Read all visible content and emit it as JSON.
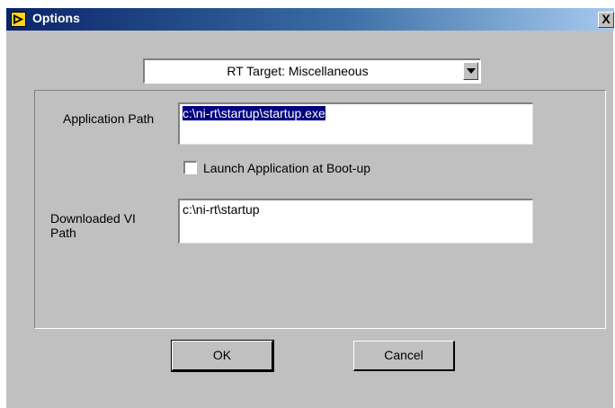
{
  "window": {
    "title": "Options",
    "close_label": "X"
  },
  "category_select": {
    "selected": "RT Target: Miscellaneous"
  },
  "application_path": {
    "label": "Application Path",
    "value": "c:\\ni-rt\\startup\\startup.exe"
  },
  "launch_checkbox": {
    "label": "Launch Application at Boot-up",
    "checked": false
  },
  "downloaded_vi_path": {
    "label_line1": "Downloaded VI",
    "label_line2": "Path",
    "value": "c:\\ni-rt\\startup"
  },
  "buttons": {
    "ok_label": "OK",
    "cancel_label": "Cancel"
  }
}
